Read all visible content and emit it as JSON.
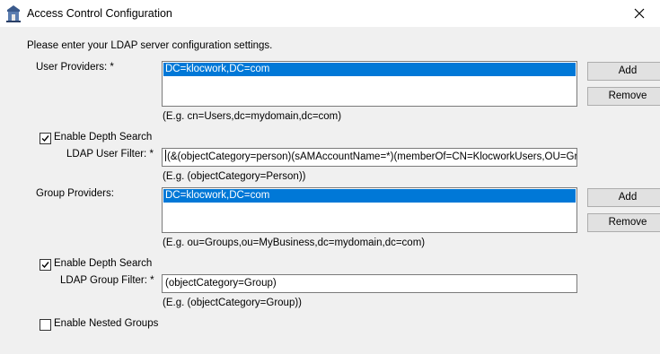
{
  "window": {
    "title": "Access Control Configuration"
  },
  "intro": "Please enter your LDAP server configuration settings.",
  "user_providers": {
    "label": "User Providers: *",
    "items": [
      "DC=klocwork,DC=com"
    ],
    "hint": "(E.g. cn=Users,dc=mydomain,dc=com)",
    "add_label": "Add",
    "remove_label": "Remove"
  },
  "user_depth": {
    "checkbox_label": "Enable Depth Search",
    "checked": true,
    "filter_label": "LDAP User Filter: *",
    "filter_value": "(&(objectCategory=person)(sAMAccountName=*)(memberOf=CN=KlocworkUsers,OU=Groups",
    "filter_hint": "(E.g. (objectCategory=Person))"
  },
  "group_providers": {
    "label": "Group Providers:",
    "items": [
      "DC=klocwork,DC=com"
    ],
    "hint": "(E.g. ou=Groups,ou=MyBusiness,dc=mydomain,dc=com)",
    "add_label": "Add",
    "remove_label": "Remove"
  },
  "group_depth": {
    "checkbox_label": "Enable Depth Search",
    "checked": true,
    "filter_label": "LDAP Group Filter: *",
    "filter_value": "(objectCategory=Group)",
    "filter_hint": "(E.g. (objectCategory=Group))"
  },
  "nested": {
    "checkbox_label": "Enable Nested Groups",
    "checked": false
  }
}
